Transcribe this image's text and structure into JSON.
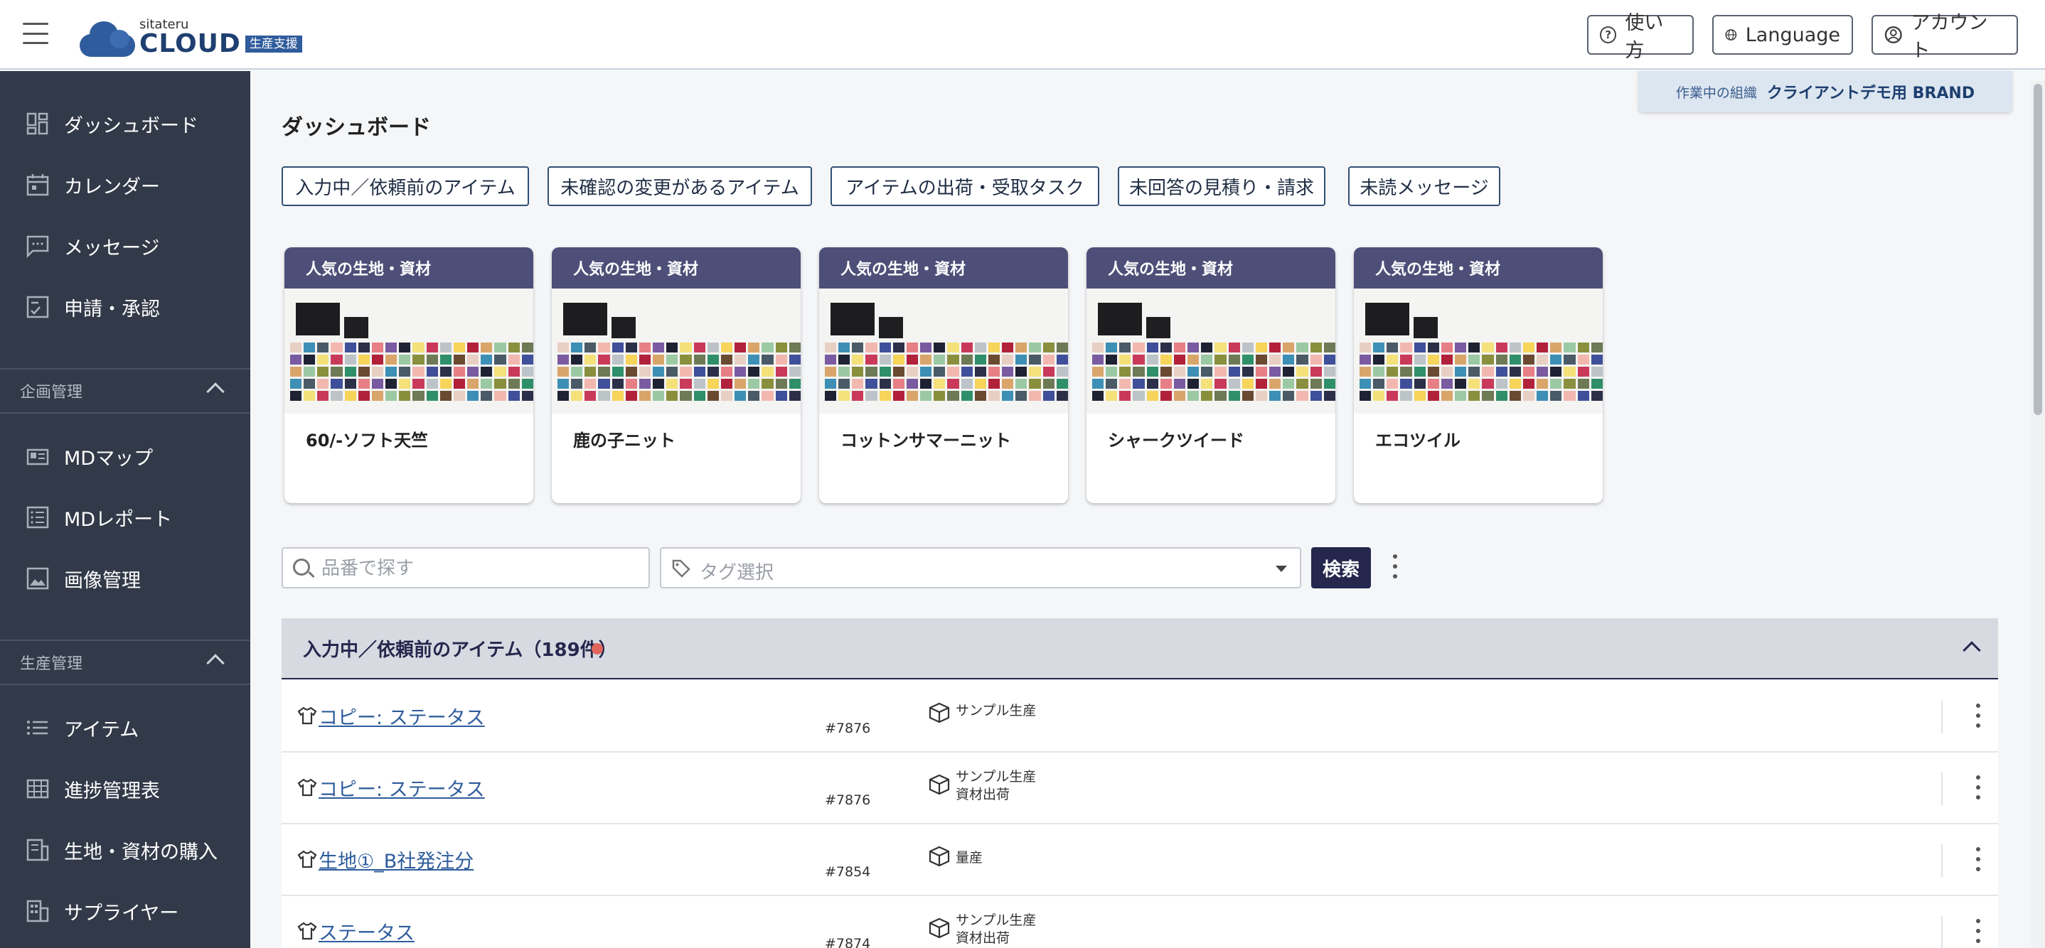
{
  "header": {
    "logo_small": "sitateru",
    "logo_big": "CLOUD",
    "logo_badge": "生産支援",
    "help_label": "使い方",
    "language_label": "Language",
    "account_label": "アカウント"
  },
  "sidebar": {
    "top_items": [
      {
        "label": "ダッシュボード",
        "icon": "dashboard-icon"
      },
      {
        "label": "カレンダー",
        "icon": "calendar-icon"
      },
      {
        "label": "メッセージ",
        "icon": "message-icon"
      },
      {
        "label": "申請・承認",
        "icon": "approval-icon"
      }
    ],
    "section_planning": "企画管理",
    "planning_items": [
      {
        "label": "MDマップ",
        "icon": "md-map-icon"
      },
      {
        "label": "MDレポート",
        "icon": "md-report-icon"
      },
      {
        "label": "画像管理",
        "icon": "image-icon"
      }
    ],
    "section_production": "生産管理",
    "production_items": [
      {
        "label": "アイテム",
        "icon": "list-icon"
      },
      {
        "label": "進捗管理表",
        "icon": "grid-icon"
      },
      {
        "label": "生地・資材の購入",
        "icon": "purchase-icon"
      },
      {
        "label": "サプライヤー",
        "icon": "building-icon"
      }
    ]
  },
  "org_banner": {
    "label": "作業中の組織",
    "value": "クライアントデモ用 BRAND"
  },
  "page_title": "ダッシュボード",
  "filters": [
    "入力中／依頼前のアイテム",
    "未確認の変更があるアイテム",
    "アイテムの出荷・受取タスク",
    "未回答の見積り・請求",
    "未読メッセージ"
  ],
  "cards": [
    {
      "header": "人気の生地・資材",
      "name": "60/-ソフト天竺"
    },
    {
      "header": "人気の生地・資材",
      "name": "鹿の子ニット"
    },
    {
      "header": "人気の生地・資材",
      "name": "コットンサマーニット"
    },
    {
      "header": "人気の生地・資材",
      "name": "シャークツイード"
    },
    {
      "header": "人気の生地・資材",
      "name": "エコツイル"
    }
  ],
  "search": {
    "placeholder": "品番で探す",
    "tag_placeholder": "タグ選択",
    "button_label": "検索"
  },
  "list": {
    "title": "入力中／依頼前のアイテム（189件）",
    "status_color": "#e2665d",
    "rows": [
      {
        "name": "コピー: ステータス",
        "number": "#7876",
        "phase": [
          "サンプル生産"
        ]
      },
      {
        "name": "コピー: ステータス",
        "number": "#7876",
        "phase": [
          "サンプル生産",
          "資材出荷"
        ]
      },
      {
        "name": "生地①_B社発注分",
        "number": "#7854",
        "phase": [
          "量産"
        ]
      },
      {
        "name": "ステータス",
        "number": "#7874",
        "phase": [
          "サンプル生産",
          "資材出荷"
        ]
      }
    ]
  },
  "colors": {
    "sidebar_bg": "#323a49",
    "accent": "#25274d",
    "card_header": "#4d4f78",
    "link": "#2e5c9c"
  }
}
